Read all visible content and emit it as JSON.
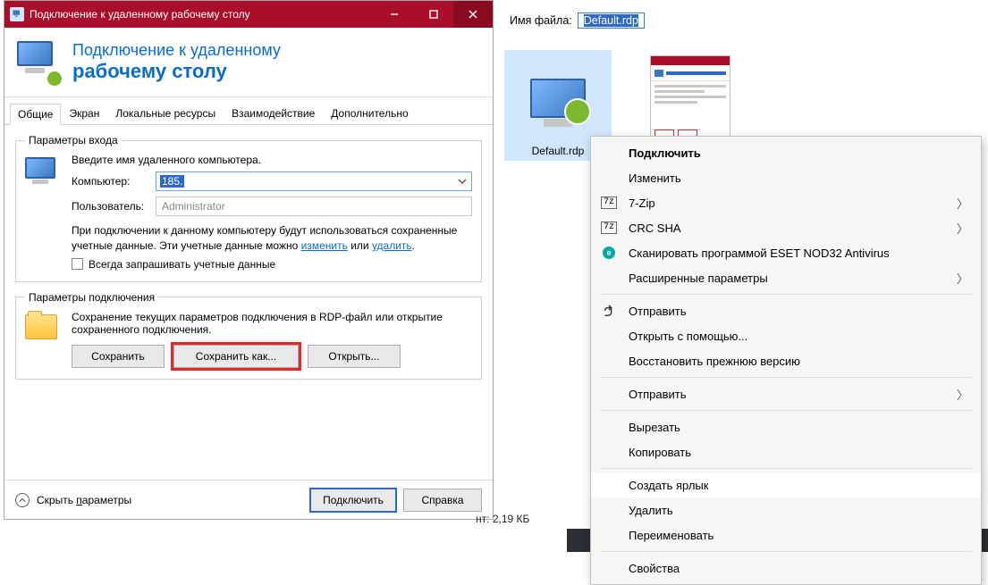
{
  "dialog": {
    "title": "Подключение к удаленному рабочему столу",
    "header_line1": "Подключение к удаленному",
    "header_line2": "рабочему столу",
    "tabs": {
      "general": "Общие",
      "display": "Экран",
      "local": "Локальные ресурсы",
      "experience": "Взаимодействие",
      "advanced": "Дополнительно"
    },
    "login_group": {
      "legend": "Параметры входа",
      "instruction": "Введите имя удаленного компьютера.",
      "computer_label": "Компьютер:",
      "computer_value": "185.",
      "user_label": "Пользователь:",
      "user_value": "Administrator",
      "info1": "При подключении к данному компьютеру будут использоваться сохраненные учетные данные. Эти учетные данные можно ",
      "link_edit": "изменить",
      "info_or": " или ",
      "link_delete": "удалить",
      "info_end": ".",
      "checkbox_label": "Всегда запрашивать учетные данные"
    },
    "conn_group": {
      "legend": "Параметры подключения",
      "info": "Сохранение текущих параметров подключения в RDP-файл или открытие сохраненного подключения.",
      "btn_save": "Сохранить",
      "btn_saveas": "Сохранить как...",
      "btn_open": "Открыть..."
    },
    "footer": {
      "toggle_pre": "Скрыть ",
      "toggle_accel": "п",
      "toggle_post": "араметры",
      "connect": "Подключить",
      "help": "Справка"
    }
  },
  "explorer": {
    "filename_label": "Имя файла:",
    "filename_value": "Default.rdp",
    "thumb1_label": "Default.rdp",
    "size_label": "нт:",
    "size_value": "2,19 КБ"
  },
  "menu": {
    "connect": "Подключить",
    "edit": "Изменить",
    "sevenzip": "7-Zip",
    "crcsha": "CRC SHA",
    "eset": "Сканировать программой ESET NOD32 Antivirus",
    "advanced_params": "Расширенные параметры",
    "send": "Отправить",
    "open_with": "Открыть с помощью...",
    "restore": "Восстановить прежнюю версию",
    "send2": "Отправить",
    "cut": "Вырезать",
    "copy": "Копировать",
    "shortcut": "Создать ярлык",
    "delete": "Удалить",
    "rename": "Переименовать",
    "properties": "Свойства"
  }
}
